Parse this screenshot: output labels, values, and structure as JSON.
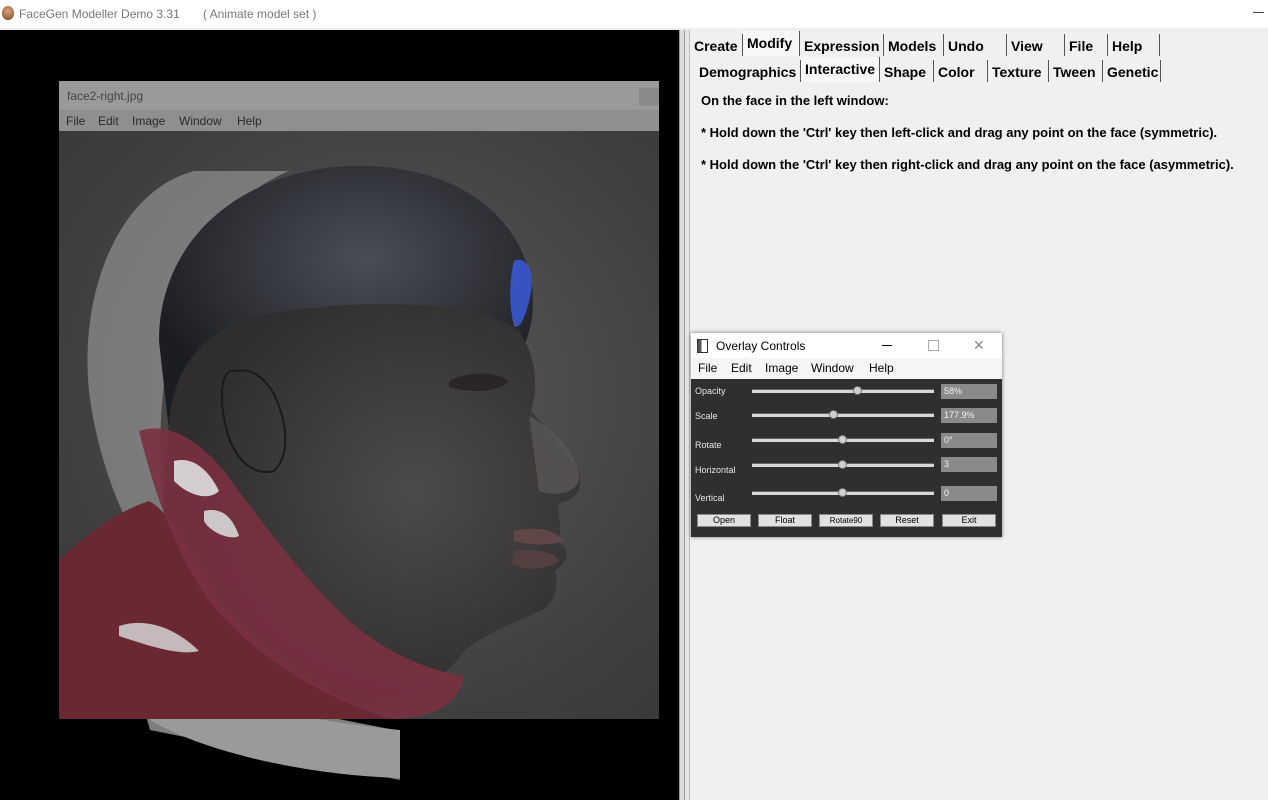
{
  "app": {
    "title": "FaceGen Modeller Demo 3.31",
    "subtitle": "( Animate model set )"
  },
  "image_window": {
    "title": "face2-right.jpg",
    "menu": [
      "File",
      "Edit",
      "Image",
      "Window",
      "Help"
    ]
  },
  "tabs_row1": [
    "Create",
    "Modify",
    "Expression",
    "Models",
    "Undo",
    "View",
    "File",
    "Help"
  ],
  "tabs_row2": [
    "Demographics",
    "Interactive",
    "Shape",
    "Color",
    "Texture",
    "Tween",
    "Genetic"
  ],
  "active_tab_row1": "Modify",
  "active_tab_row2": "Interactive",
  "instructions": {
    "line1": "On the face in the left window:",
    "line2": "* Hold down the 'Ctrl' key then left-click and drag any point on the face (symmetric).",
    "line3": "* Hold down the 'Ctrl' key then right-click and drag any point on the face (asymmetric)."
  },
  "overlay_controls": {
    "title": "Overlay Controls",
    "menu": [
      "File",
      "Edit",
      "Image",
      "Window",
      "Help"
    ],
    "sliders": [
      {
        "label": "Opacity",
        "value": "58%",
        "level": 0.58
      },
      {
        "label": "Scale",
        "value": "177.9%",
        "level": 0.45
      },
      {
        "label": "Rotate",
        "value": "0°",
        "level": 0.5
      },
      {
        "label": "Horizontal",
        "value": "3",
        "level": 0.5
      },
      {
        "label": "Vertical",
        "value": "0",
        "level": 0.5
      }
    ],
    "buttons": [
      "Open",
      "Float",
      "Rotate90",
      "Reset",
      "Exit"
    ]
  }
}
